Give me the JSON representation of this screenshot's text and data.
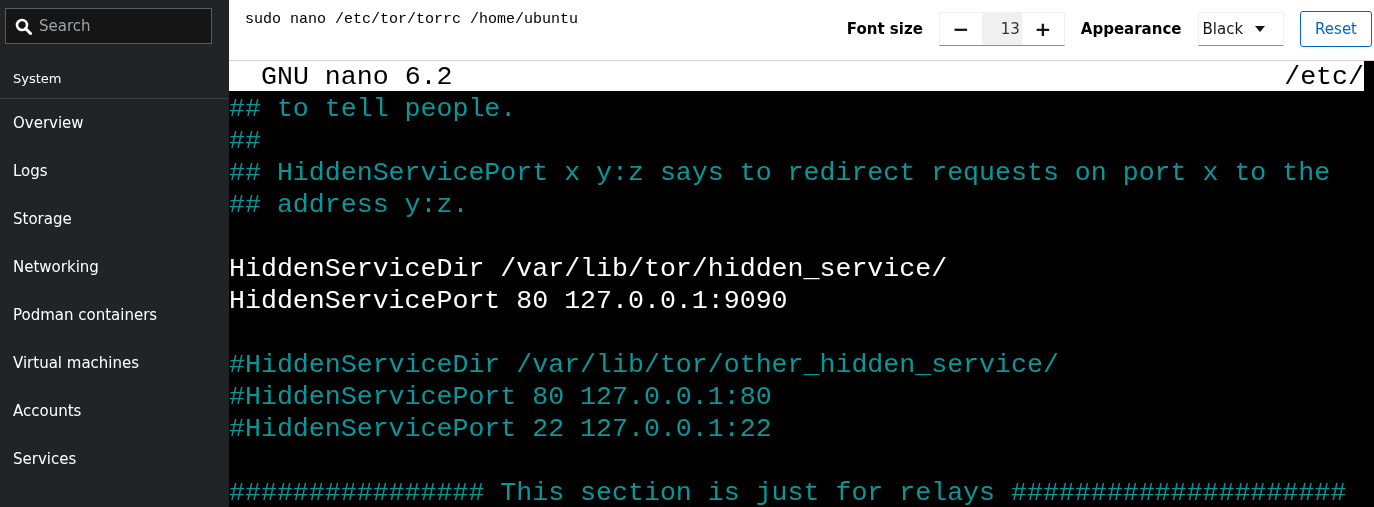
{
  "sidebar": {
    "search": {
      "placeholder": "Search"
    },
    "section": "System",
    "items": [
      {
        "label": "Overview",
        "selected": false
      },
      {
        "label": "Logs",
        "selected": false
      },
      {
        "label": "Storage",
        "selected": false
      },
      {
        "label": "Networking",
        "selected": false
      },
      {
        "label": "Podman containers",
        "selected": false
      },
      {
        "label": "Virtual machines",
        "selected": false
      },
      {
        "label": "Accounts",
        "selected": false
      },
      {
        "label": "Services",
        "selected": false
      }
    ]
  },
  "toolbar": {
    "command": "sudo nano /etc/tor/torrc /home/ubuntu",
    "font_size_label": "Font size",
    "decrease": "−",
    "font_size": "13",
    "increase": "+",
    "appearance_label": "Appearance",
    "appearance": "Black",
    "reset": "Reset"
  },
  "terminal": {
    "title_left": "GNU nano 6.2",
    "title_right": "/etc/",
    "lines": [
      {
        "kind": "comment",
        "text": "## to tell people."
      },
      {
        "kind": "comment",
        "text": "##"
      },
      {
        "kind": "comment",
        "text": "## HiddenServicePort x y:z says to redirect requests on port x to the"
      },
      {
        "kind": "comment",
        "text": "## address y:z."
      },
      {
        "kind": "blank"
      },
      {
        "kind": "code",
        "text": "HiddenServiceDir /var/lib/tor/hidden_service/"
      },
      {
        "kind": "code",
        "text": "HiddenServicePort 80 127.0.0.1:9090"
      },
      {
        "kind": "blank"
      },
      {
        "kind": "comment",
        "text": "#HiddenServiceDir /var/lib/tor/other_hidden_service/"
      },
      {
        "kind": "comment",
        "text": "#HiddenServicePort 80 127.0.0.1:80"
      },
      {
        "kind": "comment",
        "text": "#HiddenServicePort 22 127.0.0.1:22"
      },
      {
        "kind": "blank"
      },
      {
        "kind": "comment",
        "text": "################ This section is just for relays #####################"
      }
    ]
  }
}
